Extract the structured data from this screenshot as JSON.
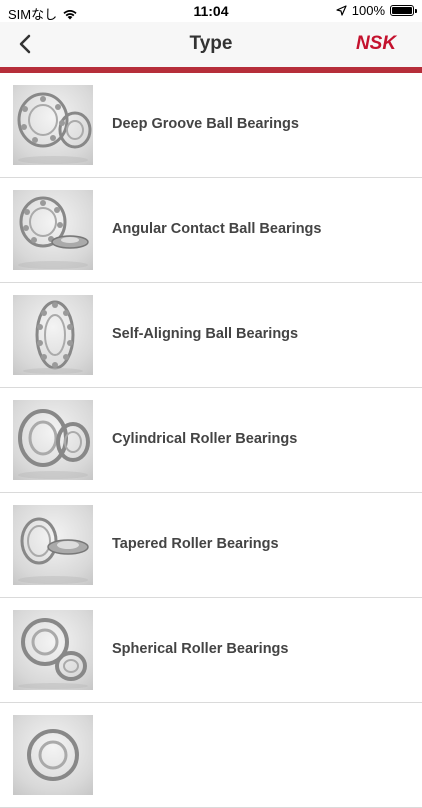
{
  "status": {
    "carrier": "SIMなし",
    "time": "11:04",
    "battery": "100%"
  },
  "nav": {
    "title": "Type",
    "logo": "NSK",
    "brand_color": "#c4122e",
    "accent_bar_color": "#b62e3a"
  },
  "items": [
    {
      "label": "Deep Groove Ball Bearings",
      "icon": "deep-groove-bearing-image"
    },
    {
      "label": "Angular Contact Ball Bearings",
      "icon": "angular-contact-bearing-image"
    },
    {
      "label": "Self-Aligning Ball Bearings",
      "icon": "self-aligning-bearing-image"
    },
    {
      "label": "Cylindrical Roller Bearings",
      "icon": "cylindrical-roller-bearing-image"
    },
    {
      "label": "Tapered Roller Bearings",
      "icon": "tapered-roller-bearing-image"
    },
    {
      "label": "Spherical Roller Bearings",
      "icon": "spherical-roller-bearing-image"
    },
    {
      "label": "",
      "icon": "bearing-image"
    }
  ]
}
